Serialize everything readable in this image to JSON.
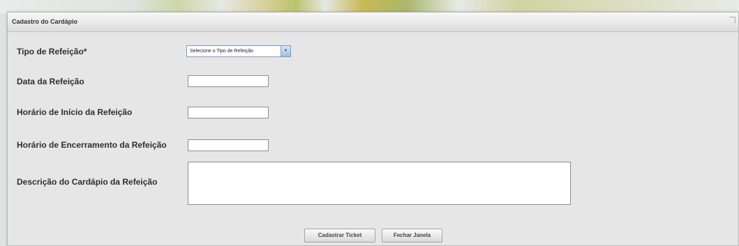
{
  "dialog": {
    "title": "Cadastro do Cardápio"
  },
  "form": {
    "tipo_label": "Tipo de Refeição*",
    "tipo_select_value": "Selecione o Tipo de Refeição",
    "data_label": "Data da Refeição",
    "data_value": "",
    "inicio_label": "Horário de Início da Refeição",
    "inicio_value": "",
    "encerramento_label": "Horário de Encerramento da Refeição",
    "encerramento_value": "",
    "descricao_label": "Descrição do Cardápio da Refeição",
    "descricao_value": ""
  },
  "buttons": {
    "cadastrar": "Cadastrar Ticket",
    "fechar": "Fechar Janela"
  },
  "icons": {
    "dropdown": "chevron-down-icon",
    "resize": "resize-icon"
  },
  "colors": {
    "dialog_bg": "#e6e6e6",
    "select_border": "#7b9cc2"
  }
}
